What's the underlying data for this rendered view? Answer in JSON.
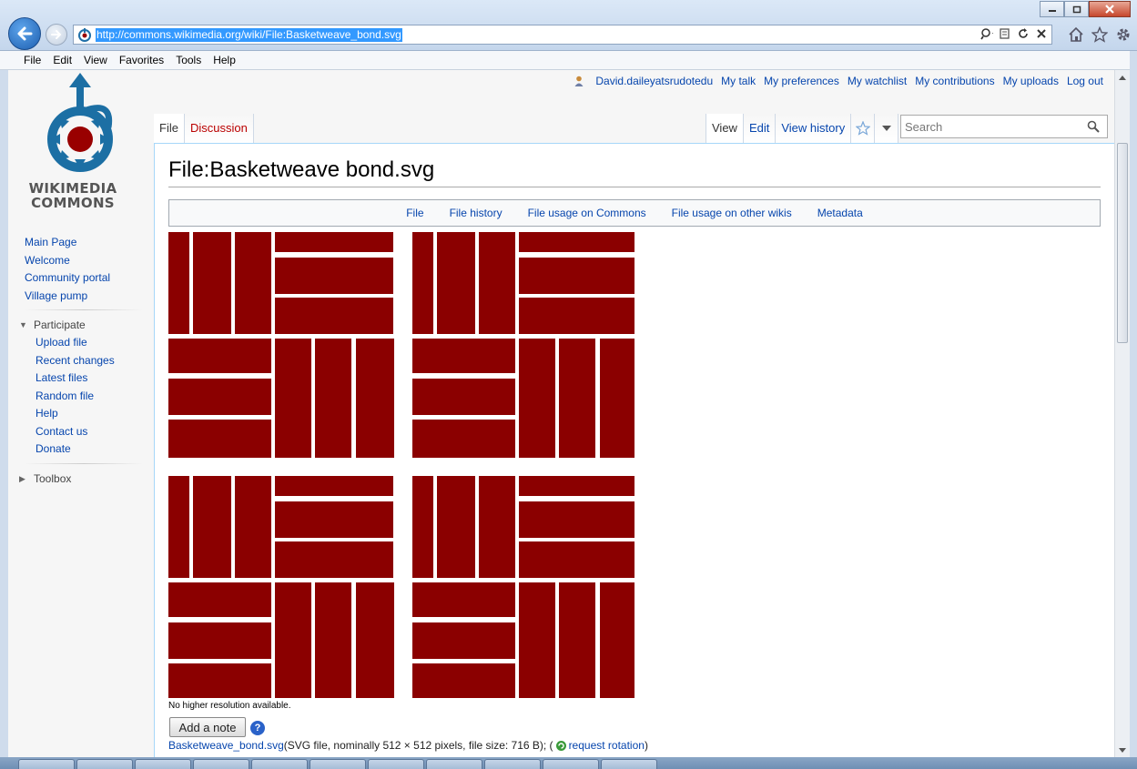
{
  "browser": {
    "url": "http://commons.wikimedia.org/wiki/File:Basketweave_bond.svg",
    "menu": [
      "File",
      "Edit",
      "View",
      "Favorites",
      "Tools",
      "Help"
    ]
  },
  "personal": {
    "user": "David.daileyatsrudotedu",
    "links": [
      "My talk",
      "My preferences",
      "My watchlist",
      "My contributions",
      "My uploads",
      "Log out"
    ]
  },
  "logo": {
    "line1": "WIKIMEDIA",
    "line2": "COMMONS"
  },
  "sidebar": {
    "main_links": [
      "Main Page",
      "Welcome",
      "Community portal",
      "Village pump"
    ],
    "participate": {
      "heading": "Participate",
      "links": [
        "Upload file",
        "Recent changes",
        "Latest files",
        "Random file",
        "Help",
        "Contact us",
        "Donate"
      ]
    },
    "toolbox": {
      "heading": "Toolbox"
    }
  },
  "tabs": {
    "left": [
      "File",
      "Discussion"
    ],
    "right": [
      "View",
      "Edit",
      "View history"
    ]
  },
  "search": {
    "placeholder": "Search"
  },
  "page": {
    "title": "File:Basketweave bond.svg",
    "toc": [
      "File",
      "File history",
      "File usage on Commons",
      "File usage on other wikis",
      "Metadata"
    ],
    "no_higher": "No higher resolution available.",
    "add_note": "Add a note",
    "help_glyph": "?",
    "file_link": "Basketweave_bond.svg",
    "file_meta": " (SVG file, nominally 512 × 512 pixels, file size: 716 B); (",
    "rotation_link": "request rotation",
    "close_paren": ")"
  },
  "colors": {
    "brick": "#8b0000",
    "mortar": "#ffffff",
    "link": "#0645ad",
    "new_link": "#ba0000"
  }
}
